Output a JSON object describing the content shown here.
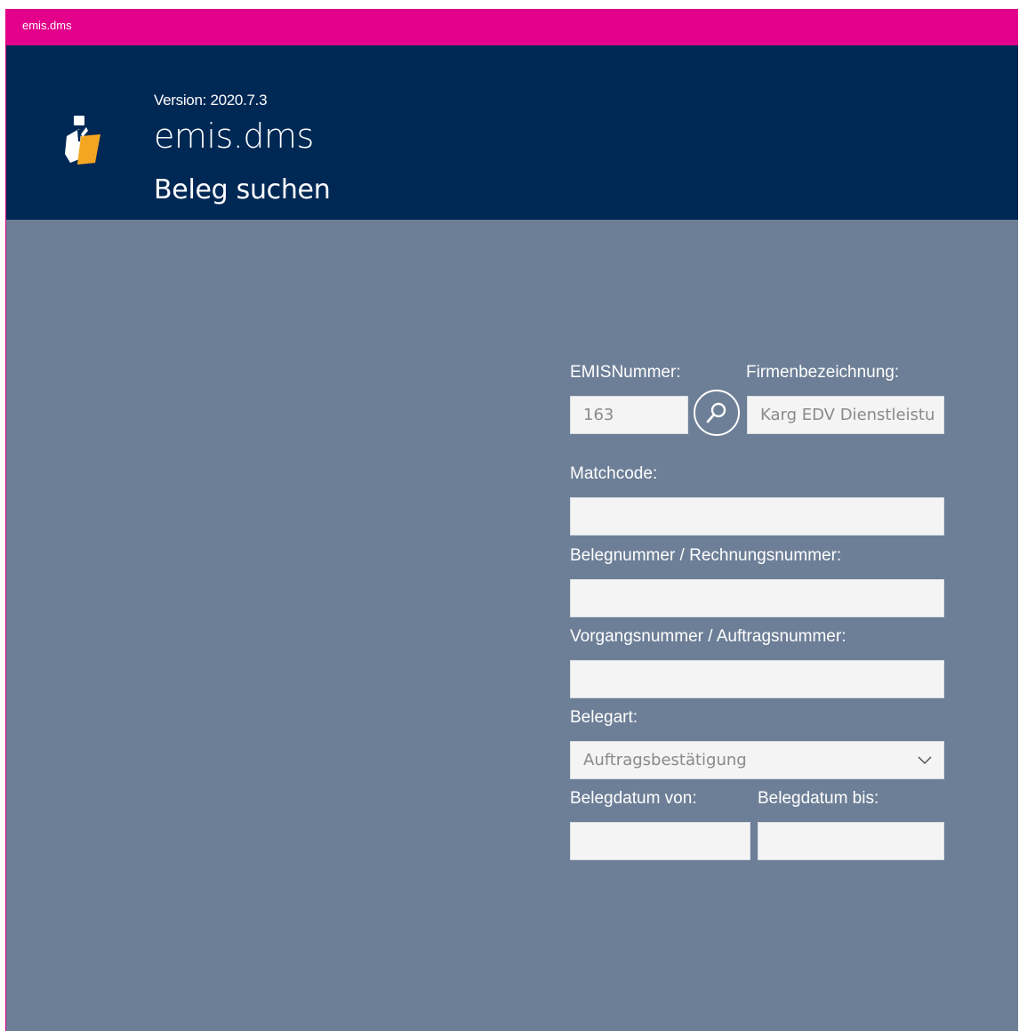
{
  "window": {
    "title": "emis.dms"
  },
  "header": {
    "version": "Version: 2020.7.3",
    "app_name": "emis.dms",
    "page_title": "Beleg suchen",
    "icon": "document-person-folder-icon"
  },
  "form": {
    "emis_nummer": {
      "label": "EMISNummer:",
      "value": "163"
    },
    "search_icon": "magnifier-icon",
    "firmenbezeichnung": {
      "label": "Firmenbezeichnung:",
      "value": "Karg EDV Dienstleistu"
    },
    "matchcode": {
      "label": "Matchcode:",
      "value": ""
    },
    "belegnummer": {
      "label": "Belegnummer / Rechnungsnummer:",
      "value": ""
    },
    "vorgangsnummer": {
      "label": "Vorgangsnummer / Auftragsnummer:",
      "value": ""
    },
    "belegart": {
      "label": "Belegart:",
      "selected": "Auftragsbestätigung"
    },
    "belegdatum_von": {
      "label": "Belegdatum von:",
      "value": ""
    },
    "belegdatum_bis": {
      "label": "Belegdatum bis:",
      "value": ""
    }
  },
  "colors": {
    "titlebar": "#e3008b",
    "header": "#002855",
    "background": "#6d7f97",
    "input": "#f4f4f4"
  }
}
